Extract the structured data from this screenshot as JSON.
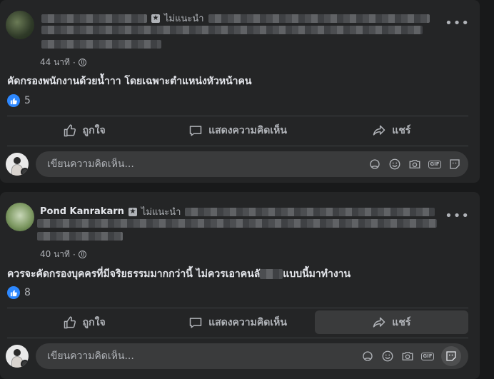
{
  "posts": [
    {
      "recommend_label": "ไม่แนะนำ",
      "time": "44 นาที",
      "privacy_dot": "·",
      "text": "คัดกรองพนักงานด้วยน้ำาา โดยเฉพาะตำแหน่งหัวหน้าคน",
      "like_count": "5",
      "actions": {
        "like": "ถูกใจ",
        "comment": "แสดงความคิดเห็น",
        "share": "แชร์"
      },
      "comment_placeholder": "เขียนความคิดเห็น..."
    },
    {
      "author_name": "Pond Kanrakarn",
      "recommend_label": "ไม่แนะนำ",
      "time": "40 นาที",
      "privacy_dot": "·",
      "text_before": "ควรจะคัดกรองบุคครที่มีจริยธรรมมากกว่านี้ ไม่ควรเอาคนลั",
      "text_after": "แบบนี้มาทำงาน",
      "like_count": "8",
      "actions": {
        "like": "ถูกใจ",
        "comment": "แสดงความคิดเห็น",
        "share": "แชร์"
      },
      "comment_placeholder": "เขียนความคิดเห็น..."
    }
  ],
  "colors": {
    "background": "#18191a",
    "card": "#242526",
    "like_blue": "#2d88ff",
    "secondary_text": "#b0b3b8"
  },
  "icons": [
    "star-badge-icon",
    "globe-icon",
    "more-icon",
    "like-reaction-icon",
    "thumbs-up-icon",
    "comment-icon",
    "share-icon",
    "avatar-sticker-icon",
    "emoji-icon",
    "camera-icon",
    "gif-icon",
    "sticker-icon"
  ]
}
